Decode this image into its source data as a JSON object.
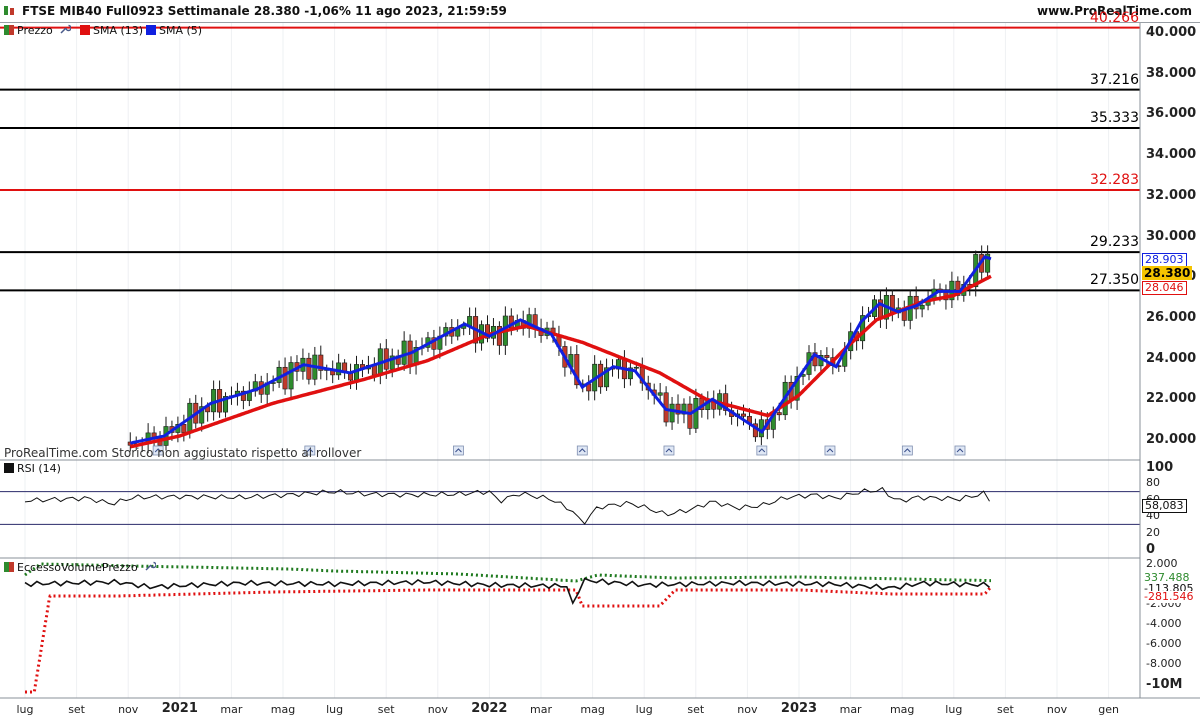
{
  "header": {
    "title": "FTSE MIB40 Full0923 Settimanale 28.380 -1,06% 11 ago 2023, 21:59:59",
    "site": "www.ProRealTime.com"
  },
  "legend_price": {
    "price": "Prezzo",
    "sma13": "SMA (13)",
    "sma5": "SMA (5)"
  },
  "legend_rsi": "RSI (14)",
  "legend_volume": "EccessoVolumePrezzo",
  "watermark": "ProRealTime.com  Storico non aggiustato rispetto ai rollover",
  "colors": {
    "up": "#2e8b2e",
    "down": "#c0392b",
    "sma13": "#e01010",
    "sma5": "#1020e0",
    "level_black": "#000000",
    "level_red": "#e01010",
    "current_price_tag": "#f5c400"
  },
  "price_levels": [
    {
      "value": 40.266,
      "label": "40.266",
      "color": "red"
    },
    {
      "value": 37.216,
      "label": "37.216",
      "color": "black"
    },
    {
      "value": 35.333,
      "label": "35.333",
      "color": "black"
    },
    {
      "value": 32.283,
      "label": "32.283",
      "color": "red"
    },
    {
      "value": 29.233,
      "label": "29.233",
      "color": "black"
    },
    {
      "value": 27.35,
      "label": "27.350",
      "color": "black"
    }
  ],
  "price_tags": {
    "sma5": "28.903",
    "last": "28.380",
    "sma13": "28.046"
  },
  "rsi_tag": "58,083",
  "volume_tags": {
    "upper": "337.488",
    "mid": "-113.805",
    "lower": "-281.546"
  },
  "x_axis": [
    {
      "label": "lug",
      "year": false
    },
    {
      "label": "set",
      "year": false
    },
    {
      "label": "nov",
      "year": false
    },
    {
      "label": "2021",
      "year": true
    },
    {
      "label": "mar",
      "year": false
    },
    {
      "label": "mag",
      "year": false
    },
    {
      "label": "lug",
      "year": false
    },
    {
      "label": "set",
      "year": false
    },
    {
      "label": "nov",
      "year": false
    },
    {
      "label": "2022",
      "year": true
    },
    {
      "label": "mar",
      "year": false
    },
    {
      "label": "mag",
      "year": false
    },
    {
      "label": "lug",
      "year": false
    },
    {
      "label": "set",
      "year": false
    },
    {
      "label": "nov",
      "year": false
    },
    {
      "label": "2023",
      "year": true
    },
    {
      "label": "mar",
      "year": false
    },
    {
      "label": "mag",
      "year": false
    },
    {
      "label": "lug",
      "year": false
    },
    {
      "label": "set",
      "year": false
    },
    {
      "label": "nov",
      "year": false
    },
    {
      "label": "gen",
      "year": false
    }
  ],
  "y_axis_price": [
    "40.000",
    "38.000",
    "36.000",
    "34.000",
    "32.000",
    "30.000",
    "28.000",
    "26.000",
    "24.000",
    "22.000",
    "20.000"
  ],
  "y_axis_rsi": [
    "100",
    "80",
    "60",
    "40",
    "20",
    "0"
  ],
  "y_axis_volume": [
    "2.000",
    "0",
    "-2.000",
    "-4.000",
    "-6.000",
    "-8.000",
    "-10M"
  ],
  "chart_data": {
    "type": "candlestick",
    "ylim": [
      19500,
      40500
    ],
    "sma13_anchors": [
      [
        2020.7,
        19200
      ],
      [
        2021.0,
        20200
      ],
      [
        2021.3,
        21800
      ],
      [
        2021.6,
        23000
      ],
      [
        2021.8,
        23900
      ],
      [
        2022.0,
        25200
      ],
      [
        2022.12,
        25600
      ],
      [
        2022.3,
        24800
      ],
      [
        2022.55,
        23300
      ],
      [
        2022.7,
        22000
      ],
      [
        2022.9,
        21200
      ],
      [
        2023.0,
        22200
      ],
      [
        2023.15,
        24500
      ],
      [
        2023.25,
        25900
      ],
      [
        2023.4,
        26800
      ],
      [
        2023.5,
        27100
      ],
      [
        2023.62,
        28046
      ]
    ],
    "sma5_anchors": [
      [
        2020.7,
        19400
      ],
      [
        2020.95,
        20200
      ],
      [
        2021.1,
        21800
      ],
      [
        2021.25,
        22500
      ],
      [
        2021.4,
        23700
      ],
      [
        2021.55,
        23300
      ],
      [
        2021.75,
        24300
      ],
      [
        2021.92,
        25700
      ],
      [
        2022.0,
        25100
      ],
      [
        2022.1,
        25900
      ],
      [
        2022.2,
        25200
      ],
      [
        2022.3,
        22600
      ],
      [
        2022.4,
        23600
      ],
      [
        2022.47,
        23400
      ],
      [
        2022.57,
        21500
      ],
      [
        2022.65,
        21300
      ],
      [
        2022.72,
        22000
      ],
      [
        2022.8,
        21200
      ],
      [
        2022.88,
        20400
      ],
      [
        2022.96,
        22200
      ],
      [
        2023.05,
        24200
      ],
      [
        2023.12,
        23600
      ],
      [
        2023.2,
        25800
      ],
      [
        2023.26,
        26700
      ],
      [
        2023.32,
        26300
      ],
      [
        2023.38,
        26600
      ],
      [
        2023.45,
        27300
      ],
      [
        2023.52,
        27300
      ],
      [
        2023.6,
        29000
      ],
      [
        2023.62,
        28903
      ]
    ]
  },
  "rsi_data": {
    "ylim": [
      0,
      100
    ],
    "overbought": 70,
    "oversold": 30,
    "anchors": [
      [
        2020.5,
        59
      ],
      [
        2020.7,
        62
      ],
      [
        2020.78,
        55
      ],
      [
        2020.85,
        63
      ],
      [
        2021.0,
        64
      ],
      [
        2021.2,
        63
      ],
      [
        2021.35,
        66
      ],
      [
        2021.5,
        70
      ],
      [
        2021.6,
        67
      ],
      [
        2021.75,
        66
      ],
      [
        2021.9,
        67
      ],
      [
        2022.0,
        70
      ],
      [
        2022.03,
        58
      ],
      [
        2022.1,
        68
      ],
      [
        2022.15,
        64
      ],
      [
        2022.2,
        61
      ],
      [
        2022.27,
        46
      ],
      [
        2022.3,
        30
      ],
      [
        2022.35,
        51
      ],
      [
        2022.45,
        56
      ],
      [
        2022.5,
        51
      ],
      [
        2022.57,
        42
      ],
      [
        2022.65,
        48
      ],
      [
        2022.72,
        58
      ],
      [
        2022.8,
        50
      ],
      [
        2022.88,
        53
      ],
      [
        2022.96,
        63
      ],
      [
        2023.05,
        66
      ],
      [
        2023.12,
        62
      ],
      [
        2023.2,
        70
      ],
      [
        2023.27,
        72
      ],
      [
        2023.32,
        58
      ],
      [
        2023.38,
        63
      ],
      [
        2023.45,
        62
      ],
      [
        2023.52,
        61
      ],
      [
        2023.6,
        68
      ],
      [
        2023.62,
        58
      ]
    ]
  },
  "volume_data": {
    "ylim": [
      -11000,
      3000
    ],
    "price_line_anchors": [
      [
        2020.5,
        0
      ],
      [
        2020.8,
        200
      ],
      [
        2020.9,
        -300
      ],
      [
        2021.2,
        100
      ],
      [
        2021.5,
        0
      ],
      [
        2021.8,
        200
      ],
      [
        2022.0,
        -100
      ],
      [
        2022.25,
        -200
      ],
      [
        2022.27,
        -2200
      ],
      [
        2022.3,
        400
      ],
      [
        2022.5,
        -100
      ],
      [
        2022.8,
        100
      ],
      [
        2023.1,
        0
      ],
      [
        2023.3,
        -400
      ],
      [
        2023.4,
        100
      ],
      [
        2023.62,
        -114
      ]
    ],
    "upper_band": [
      [
        2020.5,
        900
      ],
      [
        2020.55,
        2000
      ],
      [
        2020.85,
        1800
      ],
      [
        2021.35,
        1500
      ],
      [
        2021.5,
        1300
      ],
      [
        2021.9,
        1000
      ],
      [
        2022.28,
        300
      ],
      [
        2022.35,
        900
      ],
      [
        2022.6,
        600
      ],
      [
        2023.0,
        700
      ],
      [
        2023.62,
        337
      ]
    ],
    "lower_band": [
      [
        2020.5,
        -10800
      ],
      [
        2020.53,
        -10800
      ],
      [
        2020.58,
        -1200
      ],
      [
        2020.8,
        -1200
      ],
      [
        2021.3,
        -800
      ],
      [
        2021.8,
        -600
      ],
      [
        2022.28,
        -600
      ],
      [
        2022.3,
        -2200
      ],
      [
        2022.55,
        -2200
      ],
      [
        2022.6,
        -600
      ],
      [
        2023.0,
        -600
      ],
      [
        2023.3,
        -1000
      ],
      [
        2023.6,
        -1000
      ],
      [
        2023.62,
        -282
      ]
    ]
  }
}
